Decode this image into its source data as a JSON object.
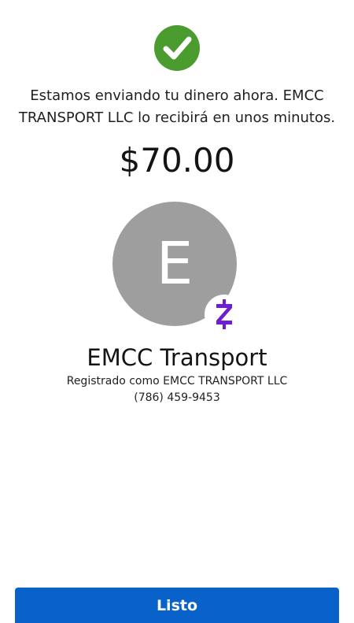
{
  "status": {
    "icon": "check-circle-icon",
    "color": "#4a9c2e",
    "message": "Estamos enviando tu dinero ahora. EMCC TRANSPORT LLC lo recibirá en unos minutos."
  },
  "payment": {
    "amount": "$70.00"
  },
  "recipient": {
    "avatar_letter": "E",
    "avatar_color": "#9e9e9e",
    "badge_icon": "zelle-logo-icon",
    "badge_color": "#6d1ed4",
    "name": "EMCC Transport",
    "registered_as": "Registrado como EMCC TRANSPORT LLC",
    "phone": "(786) 459-9453"
  },
  "actions": {
    "done_label": "Listo",
    "done_color": "#0862c9"
  }
}
